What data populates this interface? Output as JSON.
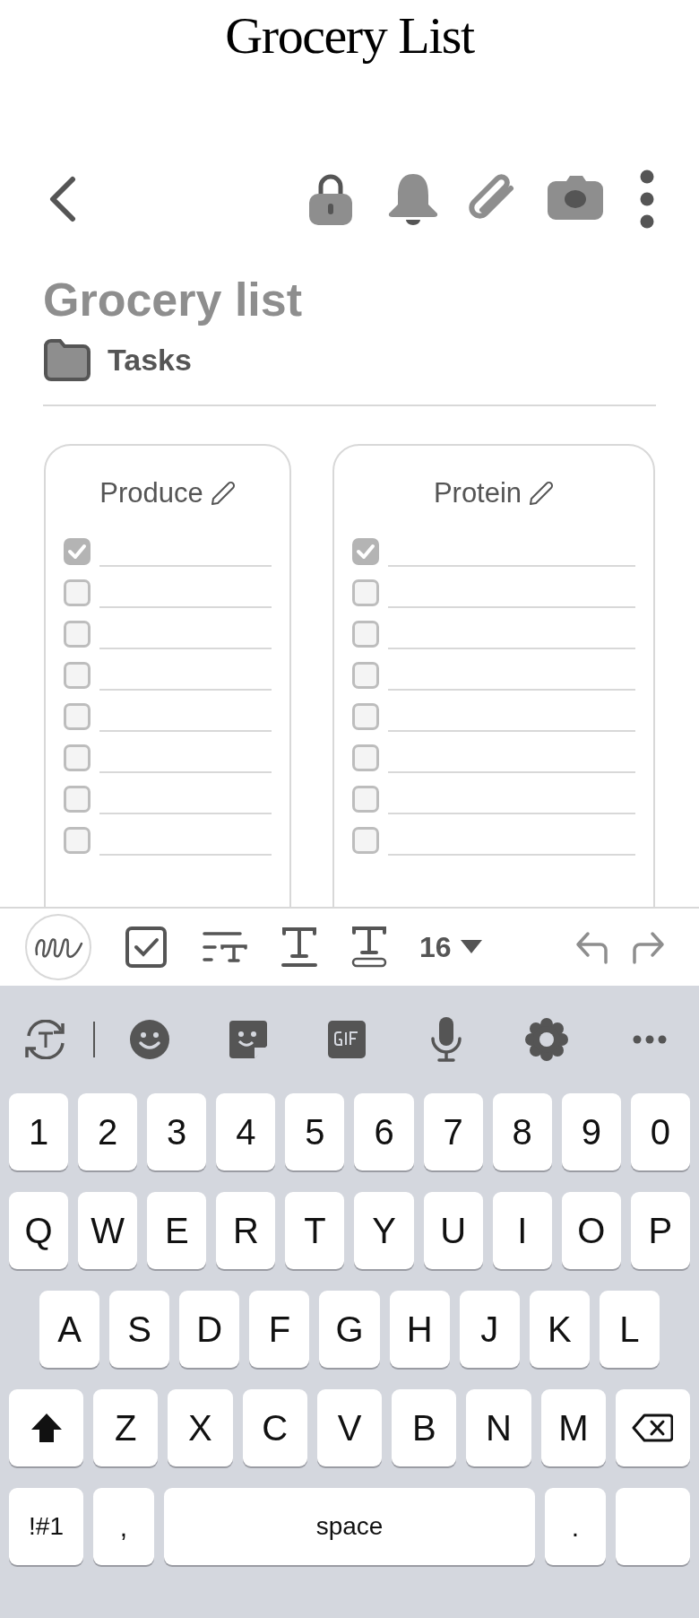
{
  "page_title": "Grocery List",
  "note": {
    "title": "Grocery list",
    "folder": "Tasks"
  },
  "lists": [
    {
      "heading": "Produce",
      "items": [
        {
          "checked": true
        },
        {
          "checked": false
        },
        {
          "checked": false
        },
        {
          "checked": false
        },
        {
          "checked": false
        },
        {
          "checked": false
        },
        {
          "checked": false
        },
        {
          "checked": false
        }
      ]
    },
    {
      "heading": "Protein",
      "items": [
        {
          "checked": true
        },
        {
          "checked": false
        },
        {
          "checked": false
        },
        {
          "checked": false
        },
        {
          "checked": false
        },
        {
          "checked": false
        },
        {
          "checked": false
        },
        {
          "checked": false
        }
      ]
    }
  ],
  "format_bar": {
    "font_size": "16"
  },
  "keyboard": {
    "rows": [
      [
        {
          "kind": "char",
          "label": "1"
        },
        {
          "kind": "char",
          "label": "2"
        },
        {
          "kind": "char",
          "label": "3"
        },
        {
          "kind": "char",
          "label": "4"
        },
        {
          "kind": "char",
          "label": "5"
        },
        {
          "kind": "char",
          "label": "6"
        },
        {
          "kind": "char",
          "label": "7"
        },
        {
          "kind": "char",
          "label": "8"
        },
        {
          "kind": "char",
          "label": "9"
        },
        {
          "kind": "char",
          "label": "0"
        }
      ],
      [
        {
          "kind": "char",
          "label": "Q"
        },
        {
          "kind": "char",
          "label": "W"
        },
        {
          "kind": "char",
          "label": "E"
        },
        {
          "kind": "char",
          "label": "R"
        },
        {
          "kind": "char",
          "label": "T"
        },
        {
          "kind": "char",
          "label": "Y"
        },
        {
          "kind": "char",
          "label": "U"
        },
        {
          "kind": "char",
          "label": "I"
        },
        {
          "kind": "char",
          "label": "O"
        },
        {
          "kind": "char",
          "label": "P"
        }
      ],
      [
        {
          "kind": "char",
          "label": "A"
        },
        {
          "kind": "char",
          "label": "S"
        },
        {
          "kind": "char",
          "label": "D"
        },
        {
          "kind": "char",
          "label": "F"
        },
        {
          "kind": "char",
          "label": "G"
        },
        {
          "kind": "char",
          "label": "H"
        },
        {
          "kind": "char",
          "label": "J"
        },
        {
          "kind": "char",
          "label": "K"
        },
        {
          "kind": "char",
          "label": "L"
        }
      ],
      [
        {
          "kind": "shift"
        },
        {
          "kind": "char",
          "label": "Z"
        },
        {
          "kind": "char",
          "label": "X"
        },
        {
          "kind": "char",
          "label": "C"
        },
        {
          "kind": "char",
          "label": "V"
        },
        {
          "kind": "char",
          "label": "B"
        },
        {
          "kind": "char",
          "label": "N"
        },
        {
          "kind": "char",
          "label": "M"
        },
        {
          "kind": "backspace"
        }
      ],
      [
        {
          "kind": "symbols",
          "label": "!#1"
        },
        {
          "kind": "punct",
          "label": ","
        },
        {
          "kind": "space",
          "label": "space"
        },
        {
          "kind": "punct",
          "label": "."
        },
        {
          "kind": "enter"
        }
      ]
    ]
  }
}
